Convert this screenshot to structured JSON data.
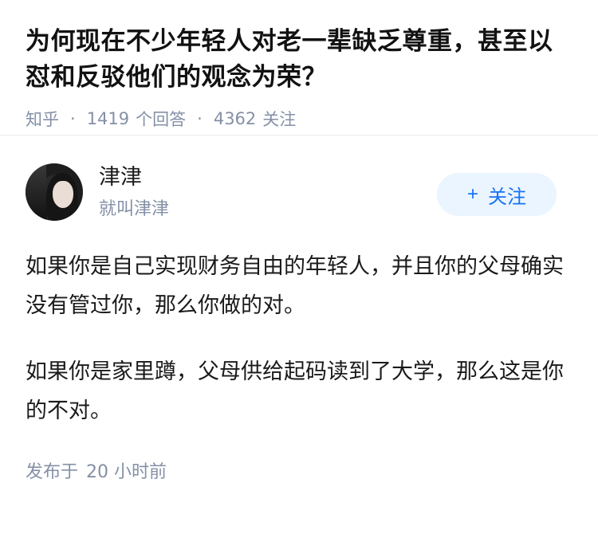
{
  "question": {
    "title": "为何现在不少年轻人对老一辈缺乏尊重，甚至以怼和反驳他们的观念为荣？",
    "source": "知乎",
    "answers_count": "1419",
    "answers_label": "个回答",
    "followers_count": "4362",
    "followers_label": "关注",
    "separator": "·"
  },
  "answer": {
    "author": {
      "name": "津津",
      "bio": "就叫津津"
    },
    "follow_button": {
      "icon": "plus-icon",
      "label": "关注"
    },
    "paragraphs": [
      "如果你是自己实现财务自由的年轻人，并且你的父母确实没有管过你，那么你做的对。",
      "如果你是家里蹲，父母供给起码读到了大学，那么这是你的不对。"
    ],
    "time_label": "发布于",
    "time_value": "20 小时前"
  },
  "colors": {
    "meta": "#8590a6",
    "accent": "#1772f6",
    "button_bg": "#ebf5ff"
  }
}
